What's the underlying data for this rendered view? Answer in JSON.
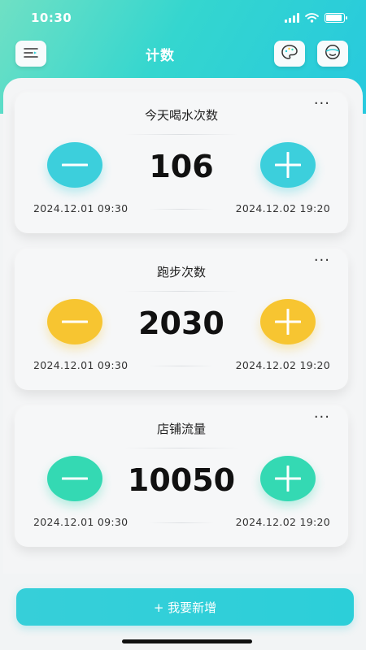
{
  "status_bar": {
    "time": "10:30",
    "battery_level": 0.9
  },
  "header": {
    "title": "计数",
    "menu_icon": "menu-icon",
    "theme_icon": "palette-icon",
    "profile_icon": "face-icon"
  },
  "counters": [
    {
      "title": "今天喝水次数",
      "value": "106",
      "start_time": "2024.12.01 09:30",
      "end_time": "2024.12.02 19:20",
      "accent": "#3ccfdc",
      "more": "···"
    },
    {
      "title": "跑步次数",
      "value": "2030",
      "start_time": "2024.12.01 09:30",
      "end_time": "2024.12.02 19:20",
      "accent": "#f7c531",
      "more": "···"
    },
    {
      "title": "店铺流量",
      "value": "10050",
      "start_time": "2024.12.01 09:30",
      "end_time": "2024.12.02 19:20",
      "accent": "#34d9b3",
      "more": "···"
    }
  ],
  "add_button": {
    "label": "+ 我要新增"
  },
  "colors": {
    "header_gradient_start": "#6fe0c4",
    "header_gradient_end": "#27c9de",
    "button": "#36cfd9"
  }
}
